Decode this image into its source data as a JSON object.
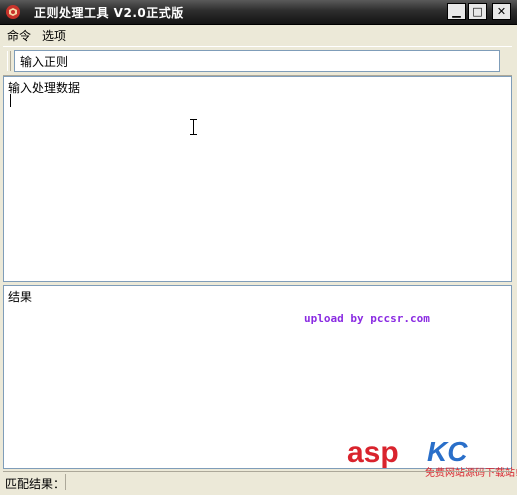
{
  "window": {
    "title": "正则处理工具 V2.0正式版",
    "controls": {
      "minimize": "▁",
      "maximize": "□",
      "close": "✕"
    },
    "icon": "app-logo-icon"
  },
  "menu": {
    "items": [
      {
        "label": "命令"
      },
      {
        "label": "选项"
      }
    ]
  },
  "regex": {
    "value": "输入正则"
  },
  "data_pane": {
    "value": "输入处理数据"
  },
  "result_pane": {
    "value": "结果",
    "overlay_text": "upload by pccsr.com"
  },
  "watermark": {
    "brand_a": "asp",
    "brand_b": "KC",
    "sub": "免费网站源码下载站!"
  },
  "status": {
    "label": "匹配结果："
  },
  "colors": {
    "titlebar": "#2d2d2d",
    "face": "#ece9d8",
    "border": "#7f9db9"
  }
}
